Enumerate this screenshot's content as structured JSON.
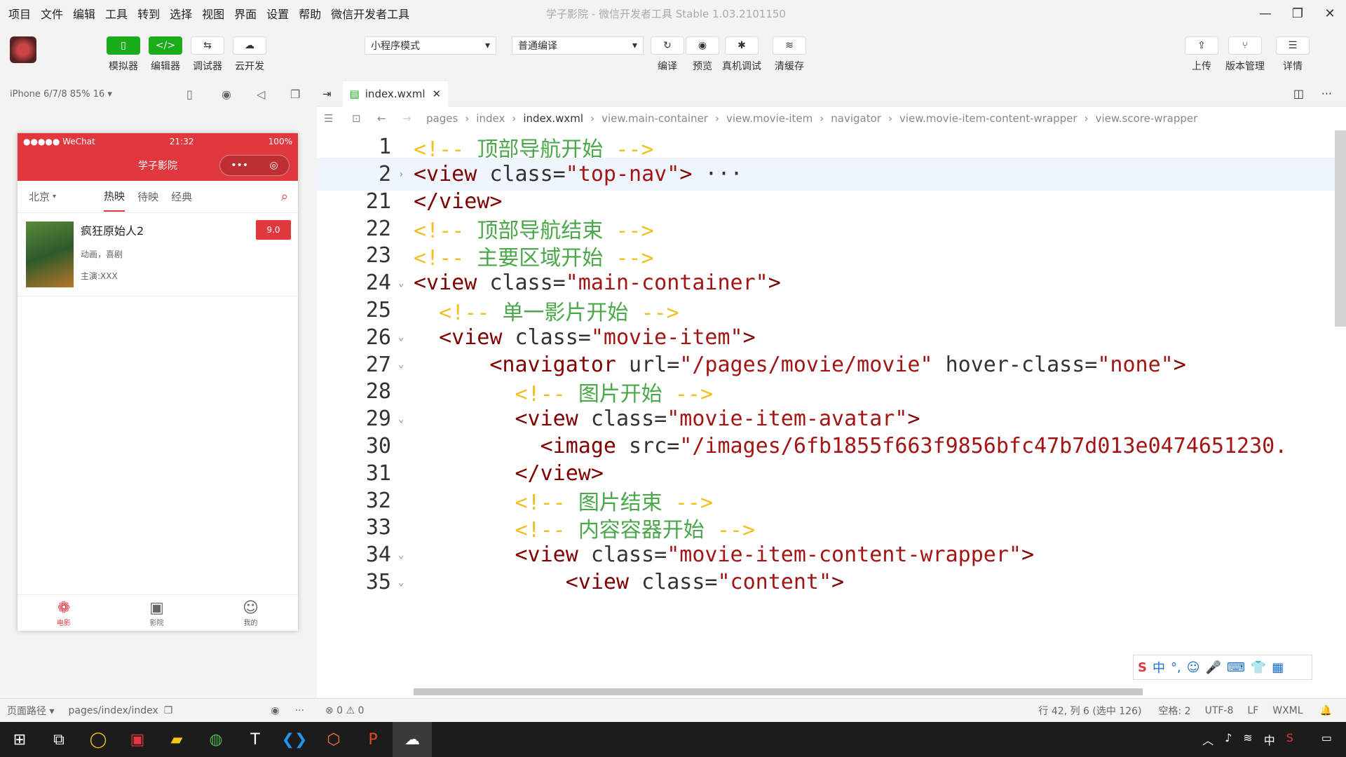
{
  "menubar": {
    "items": [
      "项目",
      "文件",
      "编辑",
      "工具",
      "转到",
      "选择",
      "视图",
      "界面",
      "设置",
      "帮助",
      "微信开发者工具"
    ],
    "title": "学子影院 - 微信开发者工具 Stable 1.03.2101150"
  },
  "toolbar": {
    "simulator": "模拟器",
    "editor": "编辑器",
    "debugger": "调试器",
    "cloud": "云开发",
    "mode_select": "小程序模式",
    "compile_select": "普通编译",
    "compile": "编译",
    "preview": "预览",
    "remote_debug": "真机调试",
    "clear_cache": "清缓存",
    "upload": "上传",
    "version": "版本管理",
    "details": "详情"
  },
  "simulator": {
    "device": "iPhone 6/7/8 85% 16 ▾",
    "status_left": "●●●●● WeChat",
    "status_time": "21:32",
    "status_battery": "100%",
    "nav_title": "学子影院",
    "city": "北京",
    "tabs": [
      "热映",
      "待映",
      "经典"
    ],
    "movie": {
      "title": "疯狂原始人2",
      "score": "9.0",
      "genre": "动画，喜剧",
      "cast": "主演:XXX"
    },
    "tabbar": [
      "电影",
      "影院",
      "我的"
    ]
  },
  "editor": {
    "file_tab": "index.wxml",
    "breadcrumb": [
      "pages",
      "index",
      "index.wxml",
      "view.main-container",
      "view.movie-item",
      "navigator",
      "view.movie-item-content-wrapper",
      "view.score-wrapper"
    ],
    "lines": [
      {
        "n": "1",
        "parts": [
          [
            "c",
            "<!-- "
          ],
          [
            "z",
            "顶部导航开始"
          ],
          [
            "c",
            " -->"
          ]
        ]
      },
      {
        "n": "2",
        "parts": [
          [
            "t",
            "<view "
          ],
          [
            "a",
            "class="
          ],
          [
            "s",
            "\"top-nav\""
          ],
          [
            "t",
            ">"
          ],
          [
            "a",
            " ···"
          ]
        ]
      },
      {
        "n": "21",
        "parts": [
          [
            "t",
            "</view>"
          ]
        ]
      },
      {
        "n": "22",
        "parts": [
          [
            "c",
            "<!-- "
          ],
          [
            "z",
            "顶部导航结束"
          ],
          [
            "c",
            " -->"
          ]
        ]
      },
      {
        "n": "23",
        "parts": [
          [
            "c",
            "<!-- "
          ],
          [
            "z",
            "主要区域开始"
          ],
          [
            "c",
            " -->"
          ]
        ]
      },
      {
        "n": "24",
        "parts": [
          [
            "t",
            "<view "
          ],
          [
            "a",
            "class="
          ],
          [
            "s",
            "\"main-container\""
          ],
          [
            "t",
            ">"
          ]
        ]
      },
      {
        "n": "25",
        "parts": [
          [
            "c",
            "  <!-- "
          ],
          [
            "z",
            "单一影片开始"
          ],
          [
            "c",
            " -->"
          ]
        ]
      },
      {
        "n": "26",
        "parts": [
          [
            "t",
            "  <view "
          ],
          [
            "a",
            "class="
          ],
          [
            "s",
            "\"movie-item\""
          ],
          [
            "t",
            ">"
          ]
        ]
      },
      {
        "n": "27",
        "parts": [
          [
            "t",
            "      <navigator "
          ],
          [
            "a",
            "url="
          ],
          [
            "s",
            "\"/pages/movie/movie\""
          ],
          [
            "a",
            " hover-class="
          ],
          [
            "s",
            "\"none\""
          ],
          [
            "t",
            ">"
          ]
        ]
      },
      {
        "n": "28",
        "parts": [
          [
            "c",
            "        <!-- "
          ],
          [
            "z",
            "图片开始"
          ],
          [
            "c",
            " -->"
          ]
        ]
      },
      {
        "n": "29",
        "parts": [
          [
            "t",
            "        <view "
          ],
          [
            "a",
            "class="
          ],
          [
            "s",
            "\"movie-item-avatar\""
          ],
          [
            "t",
            ">"
          ]
        ]
      },
      {
        "n": "30",
        "parts": [
          [
            "t",
            "          <image "
          ],
          [
            "a",
            "src="
          ],
          [
            "s",
            "\"/images/6fb1855f663f9856bfc47b7d013e0474651230."
          ]
        ]
      },
      {
        "n": "31",
        "parts": [
          [
            "t",
            "        </view>"
          ]
        ]
      },
      {
        "n": "32",
        "parts": [
          [
            "c",
            "        <!-- "
          ],
          [
            "z",
            "图片结束"
          ],
          [
            "c",
            " -->"
          ]
        ]
      },
      {
        "n": "33",
        "parts": [
          [
            "c",
            "        <!-- "
          ],
          [
            "z",
            "内容容器开始"
          ],
          [
            "c",
            " -->"
          ]
        ]
      },
      {
        "n": "34",
        "parts": [
          [
            "t",
            "        <view "
          ],
          [
            "a",
            "class="
          ],
          [
            "s",
            "\"movie-item-content-wrapper\""
          ],
          [
            "t",
            ">"
          ]
        ]
      },
      {
        "n": "35",
        "parts": [
          [
            "t",
            "            <view "
          ],
          [
            "a",
            "class="
          ],
          [
            "s",
            "\"content\""
          ],
          [
            "t",
            ">"
          ]
        ]
      }
    ]
  },
  "statusbar": {
    "page_path_label": "页面路径 ▾",
    "page_path": "pages/index/index",
    "problems": "⊗ 0 ⚠ 0",
    "cursor": "行 42, 列 6 (选中 126)",
    "spaces": "空格: 2",
    "encoding": "UTF-8",
    "eol": "LF",
    "language": "WXML"
  },
  "ime": [
    "中",
    "°,",
    "☺",
    "🎤",
    "⌨",
    "👕",
    "▦"
  ],
  "colors": {
    "accent": "#1aad19",
    "nav": "#e0383e"
  }
}
